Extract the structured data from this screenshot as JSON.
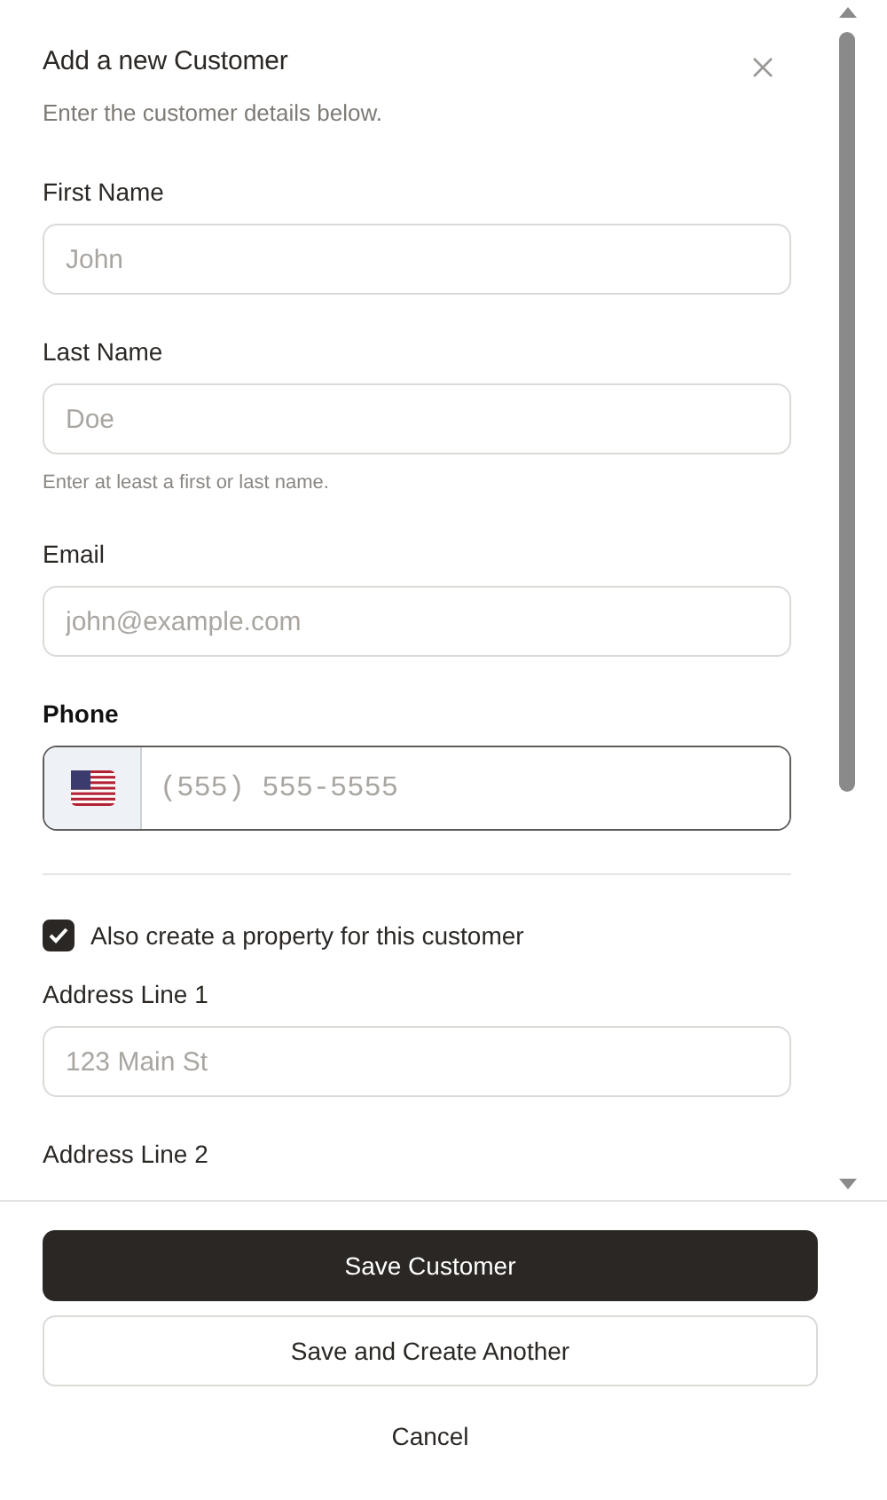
{
  "dialog": {
    "title": "Add a new Customer",
    "subtitle": "Enter the customer details below."
  },
  "fields": [
    {
      "kind": "text",
      "label": "First Name",
      "placeholder": "John"
    },
    {
      "kind": "text",
      "label": "Last Name",
      "placeholder": "Doe",
      "hint": "Enter at least a first or last name."
    },
    {
      "kind": "text",
      "label": "Email",
      "placeholder": "john@example.com"
    },
    {
      "kind": "phone",
      "label": "Phone",
      "placeholder": "(555) 555-5555",
      "focused": true
    },
    {
      "kind": "divider"
    },
    {
      "kind": "checkbox",
      "label": "Also create a property for this customer",
      "checked": true
    },
    {
      "kind": "text",
      "label": "Address Line 1",
      "placeholder": "123 Main St"
    },
    {
      "kind": "text",
      "label": "Address Line 2"
    }
  ],
  "buttons": [
    {
      "kind": "primary",
      "label": "Save Customer"
    },
    {
      "kind": "secondary",
      "label": "Save and Create Another"
    },
    {
      "kind": "plain",
      "label": "Cancel"
    }
  ]
}
